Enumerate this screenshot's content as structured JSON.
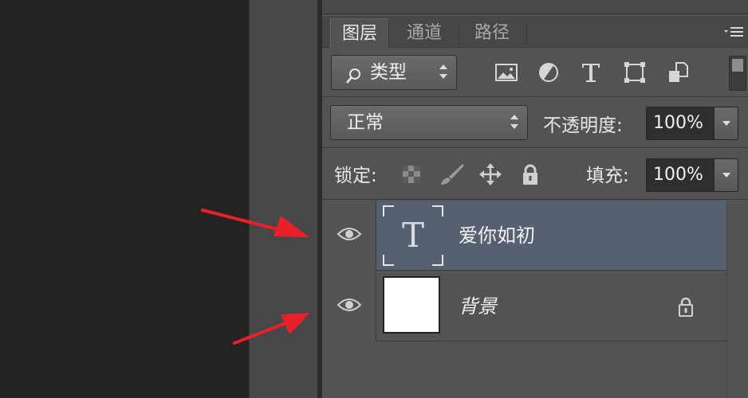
{
  "panel": {
    "tabs": [
      {
        "label": "图层",
        "active": true
      },
      {
        "label": "通道",
        "active": false
      },
      {
        "label": "路径",
        "active": false
      }
    ],
    "menu_icon": "panel-menu-icon"
  },
  "filter": {
    "kind_label": "类型",
    "icons": [
      "image-filter-icon",
      "adjustment-filter-icon",
      "type-filter-icon",
      "shape-filter-icon",
      "smart-object-filter-icon"
    ]
  },
  "blend": {
    "mode": "正常",
    "opacity_label": "不透明度:",
    "opacity_value": "100%"
  },
  "lock": {
    "label": "锁定:",
    "icons": [
      "lock-transparent-icon",
      "lock-image-icon",
      "lock-position-icon",
      "lock-all-icon"
    ],
    "fill_label": "填充:",
    "fill_value": "100%"
  },
  "layers": [
    {
      "name": "爱你如初",
      "type": "text",
      "visible": true,
      "selected": true,
      "thumb_glyph": "T"
    },
    {
      "name": "背景",
      "type": "background",
      "visible": true,
      "selected": false,
      "locked": true
    }
  ],
  "colors": {
    "selected_row": "#566071",
    "panel_bg": "#535353",
    "annotation_arrow": "#e8202a"
  }
}
